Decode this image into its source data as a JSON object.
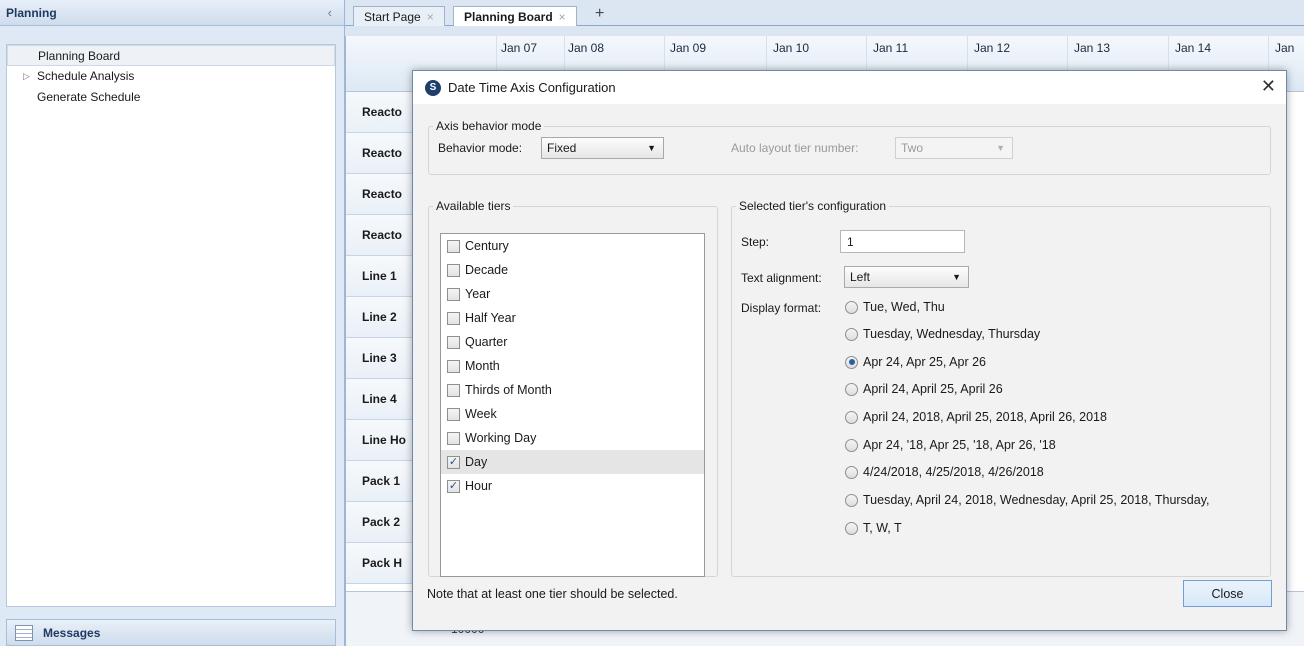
{
  "left_panel": {
    "title": "Planning",
    "collapse_glyph": "‹",
    "tree": [
      {
        "label": "Planning Board",
        "selected": true,
        "expandable": false
      },
      {
        "label": "Schedule Analysis",
        "selected": false,
        "expandable": true
      },
      {
        "label": "Generate Schedule",
        "selected": false,
        "expandable": false
      }
    ],
    "messages_label": "Messages"
  },
  "tabs": [
    {
      "label": "Start Page",
      "active": false
    },
    {
      "label": "Planning Board",
      "active": true
    }
  ],
  "new_tab_glyph": "+",
  "tab_close_glyph": "×",
  "board": {
    "dates": [
      "Jan 07",
      "Jan 08",
      "Jan 09",
      "Jan 10",
      "Jan 11",
      "Jan 12",
      "Jan 13",
      "Jan 14",
      "Jan"
    ],
    "rows": [
      "Reacto",
      "Reacto",
      "Reacto",
      "Reacto",
      "Line 1",
      "Line 2",
      "Line 3",
      "Line 4",
      "Line Ho",
      "Pack 1",
      "Pack 2",
      "Pack H"
    ],
    "bottom_value": "10000"
  },
  "dialog": {
    "title": "Date Time Axis Configuration",
    "icon_letter": "S",
    "close_glyph": "✕",
    "axis_group": {
      "legend": "Axis behavior mode",
      "behavior_label": "Behavior mode:",
      "behavior_value": "Fixed",
      "auto_tier_label": "Auto layout tier number:",
      "auto_tier_value": "Two"
    },
    "tiers_group": {
      "legend": "Available tiers",
      "tiers": [
        {
          "label": "Century",
          "checked": false
        },
        {
          "label": "Decade",
          "checked": false
        },
        {
          "label": "Year",
          "checked": false
        },
        {
          "label": "Half Year",
          "checked": false
        },
        {
          "label": "Quarter",
          "checked": false
        },
        {
          "label": "Month",
          "checked": false
        },
        {
          "label": "Thirds of Month",
          "checked": false
        },
        {
          "label": "Week",
          "checked": false
        },
        {
          "label": "Working Day",
          "checked": false
        },
        {
          "label": "Day",
          "checked": true
        },
        {
          "label": "Hour",
          "checked": true
        }
      ]
    },
    "config_group": {
      "legend": "Selected tier's configuration",
      "step_label": "Step:",
      "step_value": "1",
      "alignment_label": "Text alignment:",
      "alignment_value": "Left",
      "display_format_label": "Display format:",
      "formats": [
        {
          "label": "Tue, Wed, Thu",
          "selected": false
        },
        {
          "label": "Tuesday, Wednesday, Thursday",
          "selected": false
        },
        {
          "label": "Apr 24, Apr 25, Apr 26",
          "selected": true
        },
        {
          "label": "April 24, April 25, April 26",
          "selected": false
        },
        {
          "label": "April 24, 2018, April 25, 2018, April 26, 2018",
          "selected": false
        },
        {
          "label": "Apr 24, '18, Apr 25, '18, Apr 26, '18",
          "selected": false
        },
        {
          "label": "4/24/2018, 4/25/2018, 4/26/2018",
          "selected": false
        },
        {
          "label": "Tuesday, April 24, 2018, Wednesday, April 25, 2018, Thursday,",
          "selected": false
        },
        {
          "label": "T, W, T",
          "selected": false
        }
      ]
    },
    "note": "Note that at least one tier should be selected.",
    "close_button": "Close"
  }
}
